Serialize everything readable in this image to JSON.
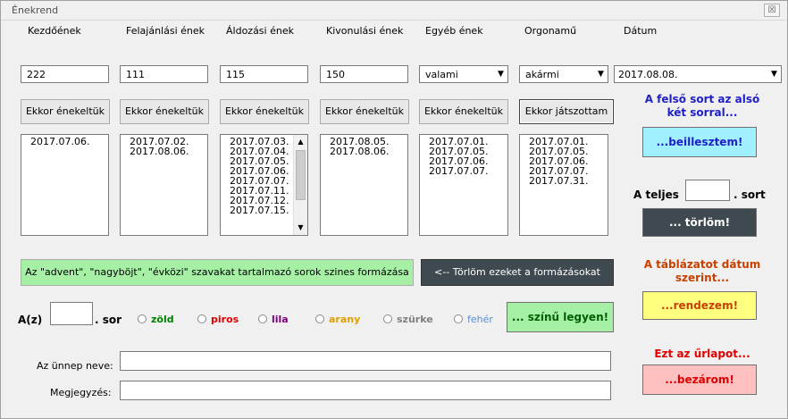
{
  "window": {
    "title": "Énekrend",
    "close_glyph": "☒"
  },
  "columns": [
    {
      "header": "Kezdőének",
      "value": "222",
      "button": "Ekkor énekeltük",
      "dates": [
        "2017.07.06."
      ]
    },
    {
      "header": "Felajánlási ének",
      "value": "111",
      "button": "Ekkor énekeltük",
      "dates": [
        "2017.07.02.",
        "2017.08.06."
      ]
    },
    {
      "header": "Áldozási ének",
      "value": "115",
      "button": "Ekkor énekeltük",
      "dates": [
        "2017.07.03.",
        "2017.07.04.",
        "2017.07.05.",
        "2017.07.06.",
        "2017.07.07.",
        "2017.07.11.",
        "2017.07.12.",
        "2017.07.15."
      ]
    },
    {
      "header": "Kivonulási ének",
      "value": "150",
      "button": "Ekkor énekeltük",
      "dates": [
        "2017.08.05.",
        "2017.08.06."
      ]
    },
    {
      "header": "Egyéb ének",
      "value": "valami",
      "button": "Ekkor énekeltük",
      "dates": [
        "2017.07.01.",
        "2017.07.05.",
        "2017.07.06.",
        "2017.07.07."
      ]
    },
    {
      "header": "Orgonamű",
      "value": "akármi",
      "button": "Ekkor játszottam",
      "dates": [
        "2017.07.01.",
        "2017.07.05.",
        "2017.07.06.",
        "2017.07.07.",
        "2017.07.31."
      ]
    }
  ],
  "date_field": {
    "header": "Dátum",
    "value": "2017.08.08."
  },
  "paste_panel": {
    "heading_line1": "A felső sort az alsó",
    "heading_line2": "két sorral...",
    "button": "...beillesztem!"
  },
  "delete_panel": {
    "prefix": "A teljes",
    "value": "",
    "suffix": ". sort",
    "button": "... törlöm!"
  },
  "sort_panel": {
    "heading_line1": "A táblázatot dátum",
    "heading_line2": "szerint...",
    "button": "...rendezem!"
  },
  "close_panel": {
    "heading": "Ezt az űrlapot...",
    "button": "...bezárom!"
  },
  "format_button": "Az \"advent\", \"nagyböjt\", \"évközi\" szavakat tartalmazó sorok szines formázása",
  "clear_format_button": "<--   Törlöm ezeket a formázásokat",
  "color_row": {
    "prefix": "A(z)",
    "value": "",
    "suffix": ". sor",
    "options": [
      {
        "label": "zöld",
        "color": "#008000"
      },
      {
        "label": "piros",
        "color": "#e00000"
      },
      {
        "label": "lila",
        "color": "#800080"
      },
      {
        "label": "arany",
        "color": "#e0a000"
      },
      {
        "label": "szürke",
        "color": "#808080"
      },
      {
        "label": "fehér",
        "color": "#5b8fd0"
      }
    ],
    "button": "... színű legyen!"
  },
  "feast_name": {
    "label": "Az ünnep neve:",
    "value": ""
  },
  "note": {
    "label": "Megjegyzés:",
    "value": ""
  },
  "colors": {
    "paste_heading": "#1f1fc8",
    "paste_button": "#a0f0ff",
    "delete_button": "#3e4a50",
    "sort_heading": "#c84000",
    "sort_button": "#ffff80",
    "close_heading": "#e00000",
    "close_button": "#ffc0c0",
    "format_button": "#a6f0a6",
    "clear_button": "#3e4a50",
    "color_button": "#a6f0a6"
  }
}
